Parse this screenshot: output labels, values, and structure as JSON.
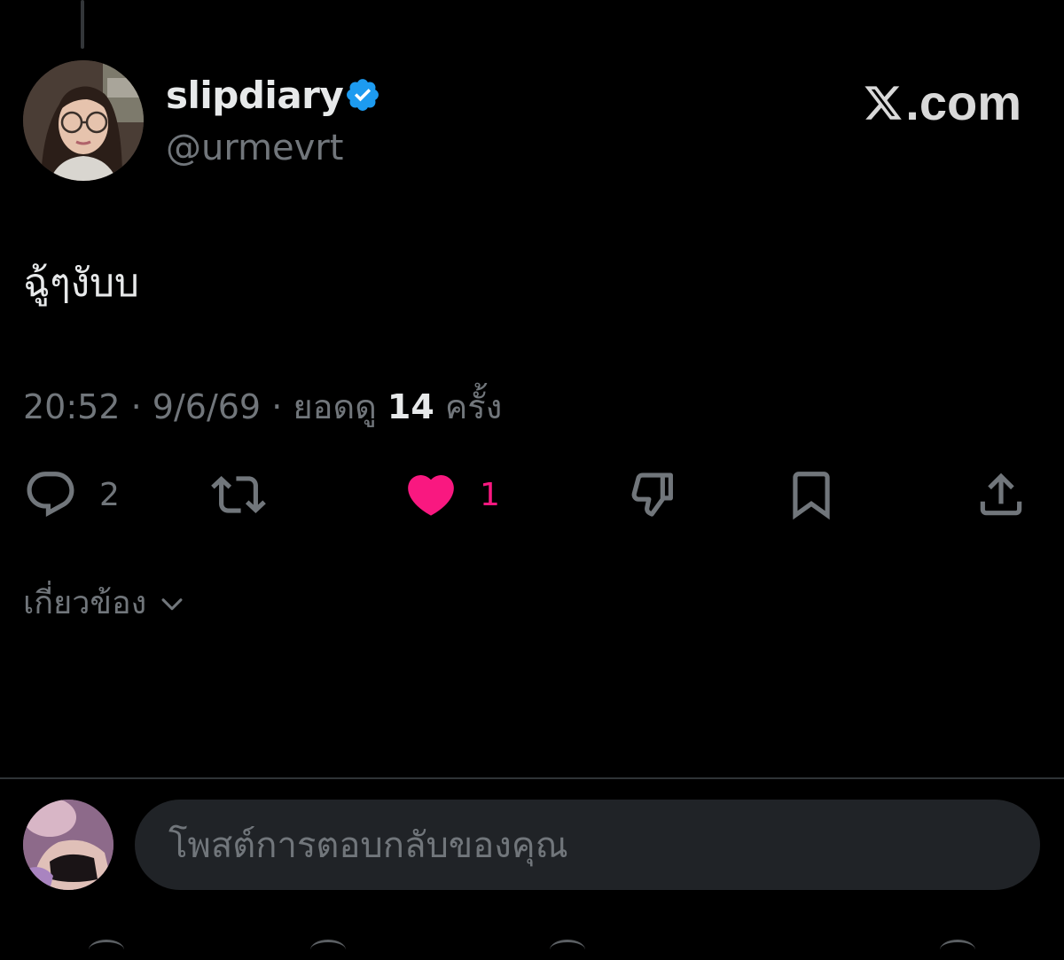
{
  "tweet": {
    "display_name": "slipdiary",
    "handle": "@urmevrt",
    "verified": true,
    "brand": ".com",
    "text": "ฉู้ๆงับบ",
    "time": "20:52",
    "date": "9/6/69",
    "views_label": "ยอดดู",
    "views_count": "14",
    "views_suffix": "ครั้ง"
  },
  "actions": {
    "reply_count": "2",
    "retweet_count": "",
    "like_count": "1",
    "liked": true
  },
  "related_label": "เกี่ยวข้อง",
  "reply_bar": {
    "placeholder": "โพสต์การตอบกลับของคุณ"
  },
  "colors": {
    "background": "#000000",
    "text_primary": "#e7e9ea",
    "text_secondary": "#71767b",
    "like": "#f91880",
    "verified": "#1d9bf0"
  },
  "icons": [
    "reply-icon",
    "retweet-icon",
    "heart-icon",
    "dislike-icon",
    "bookmark-icon",
    "share-icon",
    "verified-icon",
    "x-logo-icon",
    "chevron-down-icon"
  ]
}
